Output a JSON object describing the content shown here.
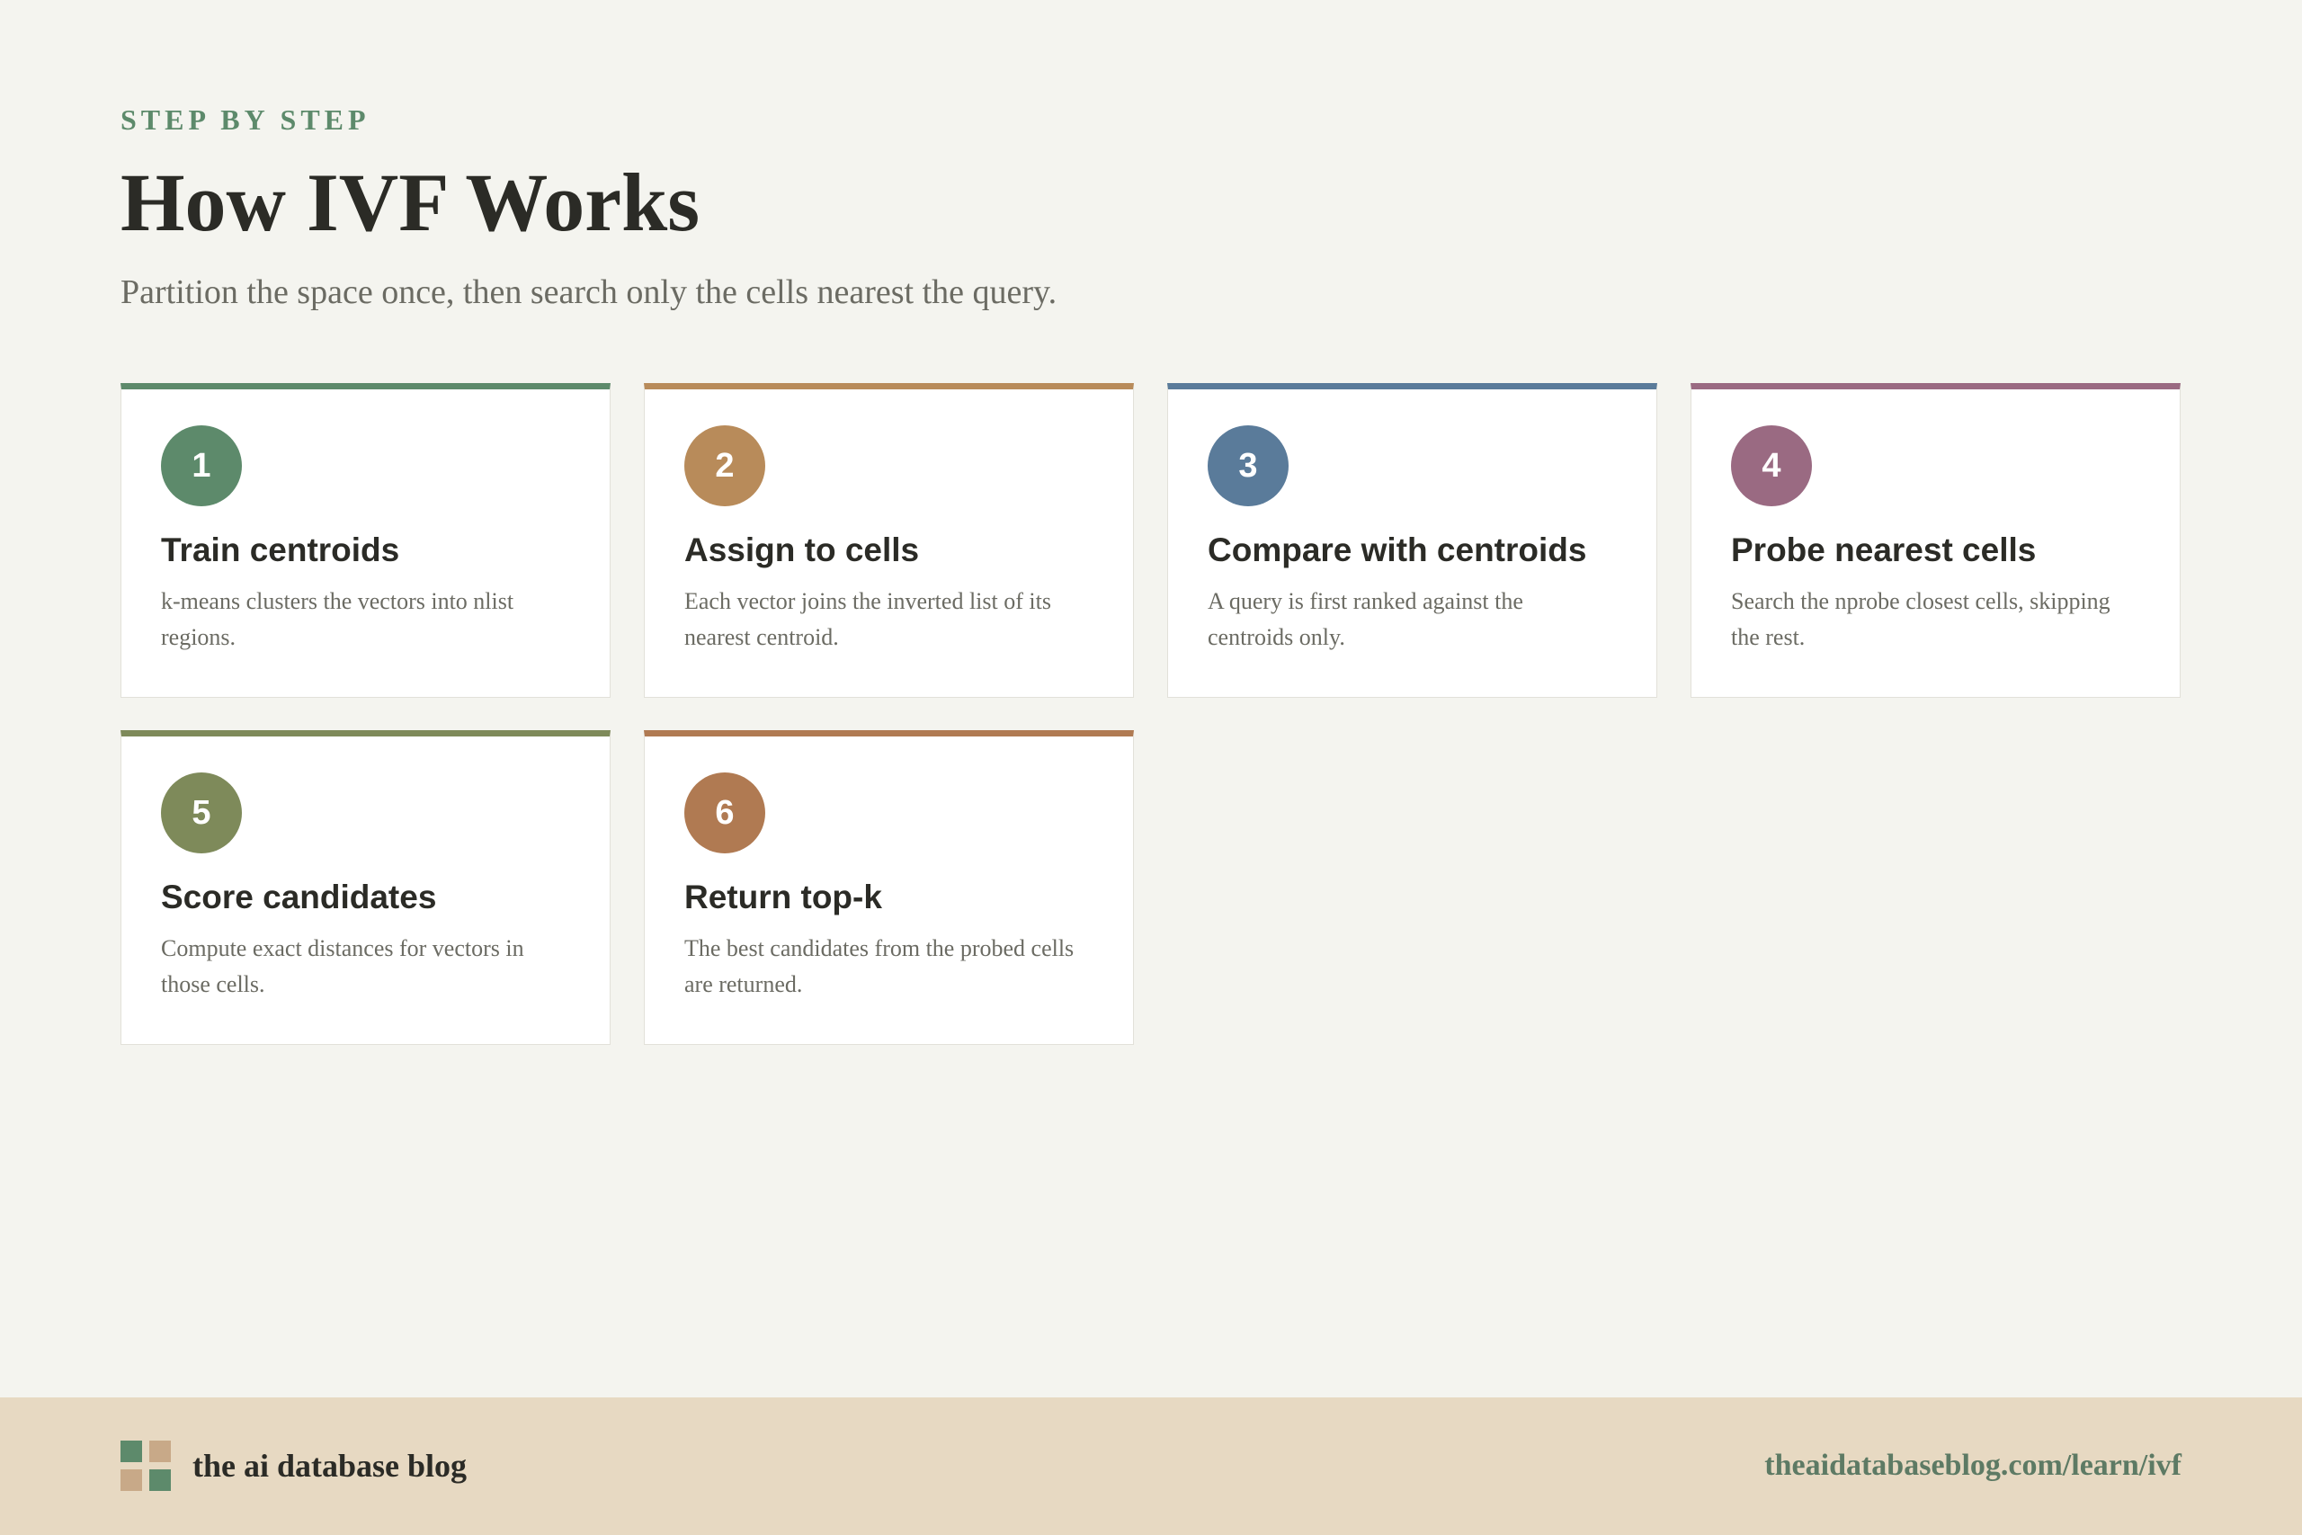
{
  "header": {
    "eyebrow": "STEP BY STEP",
    "title": "How IVF Works",
    "subtitle": "Partition the space once, then search only the cells nearest the query."
  },
  "steps": [
    {
      "number": "1",
      "title": "Train centroids",
      "description": "k-means clusters the vectors into nlist regions.",
      "color": "#5d8a6b"
    },
    {
      "number": "2",
      "title": "Assign to cells",
      "description": "Each vector joins the inverted list of its nearest centroid.",
      "color": "#b88b5a"
    },
    {
      "number": "3",
      "title": "Compare with centroids",
      "description": "A query is first ranked against the centroids only.",
      "color": "#5a7b9a"
    },
    {
      "number": "4",
      "title": "Probe nearest cells",
      "description": "Search the nprobe closest cells, skipping the rest.",
      "color": "#9a6a82"
    },
    {
      "number": "5",
      "title": "Score candidates",
      "description": "Compute exact distances for vectors in those cells.",
      "color": "#7e8a5a"
    },
    {
      "number": "6",
      "title": "Return top-k",
      "description": "The best candidates from the probed cells are returned.",
      "color": "#b07a52"
    }
  ],
  "footer": {
    "brand": "the ai database blog",
    "url": "theaidatabaseblog.com/learn/ivf",
    "logo_icon": "four-square-grid-icon"
  },
  "colors": {
    "background": "#f4f4ef",
    "footer_background": "#e7d9c2",
    "accent": "#5d8a6b"
  }
}
